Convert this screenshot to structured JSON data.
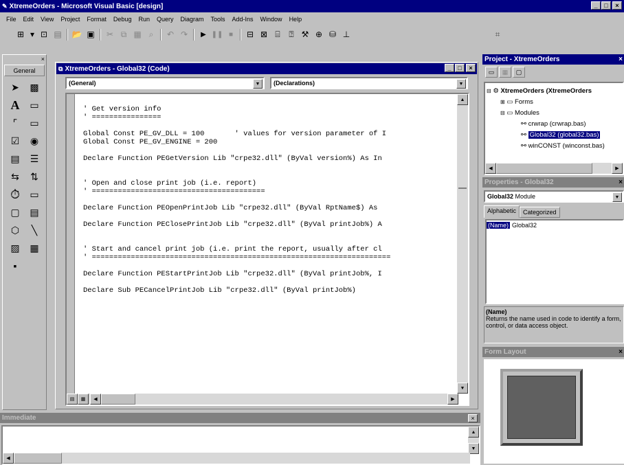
{
  "app": {
    "title": "XtremeOrders - Microsoft Visual Basic [design]"
  },
  "caption_buttons": {
    "min": "_",
    "max": "□",
    "close": "×"
  },
  "menu": [
    "File",
    "Edit",
    "View",
    "Project",
    "Format",
    "Debug",
    "Run",
    "Query",
    "Diagram",
    "Tools",
    "Add-Ins",
    "Window",
    "Help"
  ],
  "toolbox": {
    "title": "General"
  },
  "code_window": {
    "title": "XtremeOrders - Global32 (Code)",
    "object_combo": "(General)",
    "proc_combo": "(Declarations)",
    "lines": [
      "' Get version info",
      "' ================",
      "",
      "Global Const PE_GV_DLL = 100       ' values for version parameter of I",
      "Global Const PE_GV_ENGINE = 200",
      "",
      "Declare Function PEGetVersion Lib \"crpe32.dll\" (ByVal version%) As In",
      "",
      "",
      "' Open and close print job (i.e. report)",
      "' ========================================",
      "",
      "Declare Function PEOpenPrintJob Lib \"crpe32.dll\" (ByVal RptName$) As",
      "",
      "Declare Function PEClosePrintJob Lib \"crpe32.dll\" (ByVal printJob%) A",
      "",
      "",
      "' Start and cancel print job (i.e. print the report, usually after cl",
      "' =====================================================================",
      "",
      "Declare Function PEStartPrintJob Lib \"crpe32.dll\" (ByVal printJob%, I",
      "",
      "Declare Sub PECancelPrintJob Lib \"crpe32.dll\" (ByVal printJob%)"
    ]
  },
  "project": {
    "title": "Project - XtremeOrders",
    "root": "XtremeOrders (XtremeOrders",
    "forms": "Forms",
    "modules": "Modules",
    "items": [
      "crwrap (crwrap.bas)",
      "Global32 (global32.bas)",
      "winCONST (winconst.bas)"
    ],
    "selected_index": 1
  },
  "properties": {
    "title": "Properties - Global32",
    "object": "Global32",
    "object_type": "Module",
    "tabs": [
      "Alphabetic",
      "Categorized"
    ],
    "rows": [
      {
        "name": "(Name)",
        "value": "Global32"
      }
    ],
    "desc_title": "(Name)",
    "desc_text": "Returns the name used in code to identify a form, control, or data access object."
  },
  "form_layout": {
    "title": "Form Layout"
  },
  "immediate": {
    "title": "Immediate"
  }
}
